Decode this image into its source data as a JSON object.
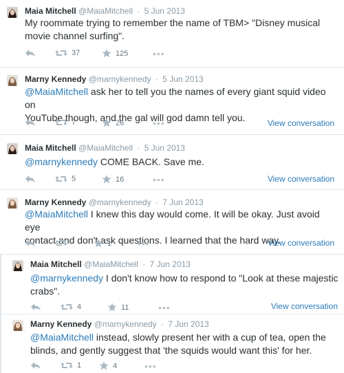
{
  "tweets": [
    {
      "name": "Maia Mitchell",
      "handle": "@MaiaMitchell",
      "time": "5 Jun 2013",
      "text_parts": [
        "My roommate trying to remember the name of TBM> \"Disney musical",
        "movie channel surfing\"."
      ],
      "retweets": "37",
      "favorites": "125",
      "view_conversation": ""
    },
    {
      "name": "Marny Kennedy",
      "handle": "@marnykennedy",
      "time": "5 Jun 2013",
      "mention": "@MaiaMitchell",
      "text_line1_rest": " ask her to tell you the names of every giant squid video on",
      "text_line2": "YouTube though, and the gal will god damn tell you.",
      "retweets": "7",
      "favorites": "26",
      "view_conversation": "View conversation"
    },
    {
      "name": "Maia Mitchell",
      "handle": "@MaiaMitchell",
      "time": "5 Jun 2013",
      "mention": "@marnykennedy",
      "text_line1_rest": " COME BACK. Save me.",
      "retweets": "5",
      "favorites": "16",
      "view_conversation": "View conversation"
    },
    {
      "name": "Marny Kennedy",
      "handle": "@marnykennedy",
      "time": "7 Jun 2013",
      "mention": "@MaiaMitchell",
      "text_line1_rest": " I knew this day would come. It will be okay. Just avoid eye",
      "text_line2": "contact and don't ask questions. I learned that the hard way.",
      "retweets": "",
      "favorites": "1",
      "view_conversation": "View conversation"
    },
    {
      "name": "Maia Mitchell",
      "handle": "@MaiaMitchell",
      "time": "7 Jun 2013",
      "mention": "@marnykennedy",
      "text_line1_rest": " I don't know how to respond to \"Look at these majestic",
      "text_line2": "crabs\".",
      "retweets": "4",
      "favorites": "11",
      "view_conversation": "View conversation"
    },
    {
      "name": "Marny Kennedy",
      "handle": "@marnykennedy",
      "time": "7 Jun 2013",
      "mention": "@MaiaMitchell",
      "text_line1_rest": " instead, slowly present her with a cup of tea, open the",
      "text_line2": "blinds, and gently suggest that 'the squids would want this' for her.",
      "retweets": "1",
      "favorites": "4",
      "view_conversation": ""
    }
  ],
  "colors": {
    "link": "#2b7bb9",
    "muted": "#8899a6",
    "icon": "#aab8c2",
    "divider": "#e1e8ed"
  },
  "icons": {
    "reply": "reply-icon",
    "retweet": "retweet-icon",
    "favorite": "favorite-star-icon",
    "more": "more-options-icon"
  }
}
